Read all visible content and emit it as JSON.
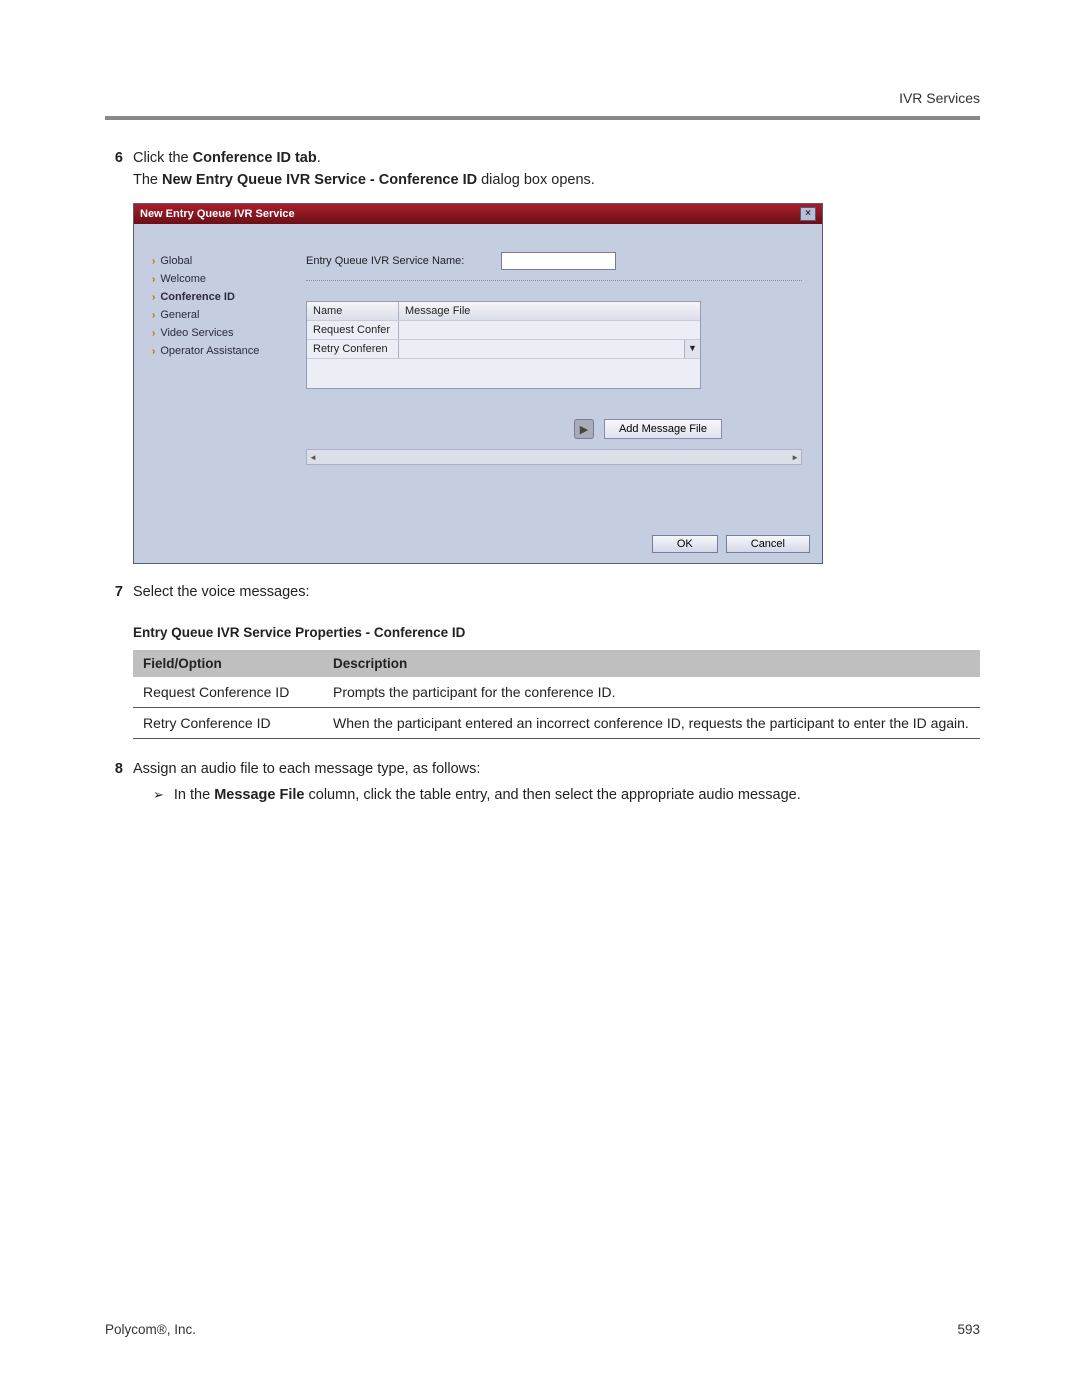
{
  "header": {
    "section": "IVR Services"
  },
  "steps": {
    "s6": {
      "num": "6",
      "line1_pre": "Click the ",
      "line1_bold": "Conference ID tab",
      "line1_post": ".",
      "line2_pre": "The ",
      "line2_bold": "New Entry Queue IVR Service - Conference ID",
      "line2_post": " dialog box opens."
    },
    "s7": {
      "num": "7",
      "text": "Select the voice messages:"
    },
    "s8": {
      "num": "8",
      "text": "Assign an audio file to each message type, as follows:",
      "bullet_pre": "In the ",
      "bullet_bold": "Message File",
      "bullet_post": " column, click the table entry, and then select the appropriate audio message."
    }
  },
  "dialog": {
    "title": "New Entry Queue IVR Service",
    "close_glyph": "×",
    "nav": [
      {
        "label": "Global",
        "active": false
      },
      {
        "label": "Welcome",
        "active": false
      },
      {
        "label": "Conference ID",
        "active": true
      },
      {
        "label": "General",
        "active": false
      },
      {
        "label": "Video Services",
        "active": false
      },
      {
        "label": "Operator Assistance",
        "active": false
      }
    ],
    "name_label": "Entry Queue IVR Service Name:",
    "name_value": "",
    "msg_table": {
      "head_name": "Name",
      "head_file": "Message File",
      "rows": [
        {
          "name": "Request Confer",
          "file": ""
        },
        {
          "name": "Retry Conferen",
          "file": ""
        }
      ]
    },
    "add_btn": "Add Message File",
    "ok": "OK",
    "cancel": "Cancel"
  },
  "prop": {
    "title": "Entry Queue IVR Service Properties - Conference ID",
    "head_field": "Field/Option",
    "head_desc": "Description",
    "rows": [
      {
        "field": "Request Conference ID",
        "desc": "Prompts the participant for the conference ID."
      },
      {
        "field": "Retry Conference ID",
        "desc": "When the participant entered an incorrect conference ID, requests the participant to enter the ID again."
      }
    ]
  },
  "footer": {
    "company": "Polycom®, Inc.",
    "page": "593"
  }
}
